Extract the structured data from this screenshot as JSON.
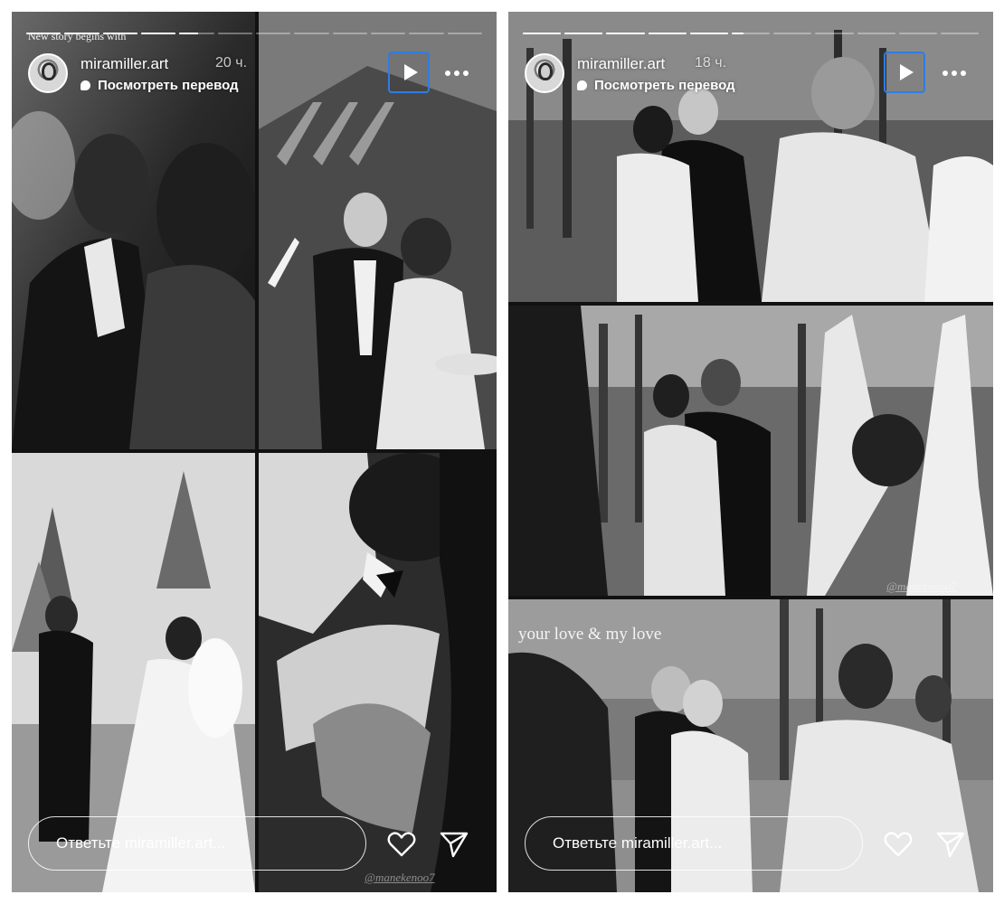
{
  "stories": [
    {
      "username": "miramiller.art",
      "time": "20 ч.",
      "translate_label": "Посмотреть перевод",
      "caption_top": "New story begins with",
      "watermark": "@manekenoo7",
      "reply_placeholder": "Ответьте miramiller.art...",
      "progress": [
        1,
        1,
        1,
        1,
        0.55,
        0,
        0,
        0,
        0,
        0,
        0,
        0
      ]
    },
    {
      "username": "miramiller.art",
      "time": "18 ч.",
      "translate_label": "Посмотреть перевод",
      "overlay_text": "your love & my love",
      "watermark": "@manekenoo7",
      "reply_placeholder": "Ответьте miramiller.art...",
      "progress": [
        1,
        1,
        1,
        1,
        1,
        0.3,
        0,
        0,
        0,
        0,
        0
      ]
    }
  ],
  "colors": {
    "focus_ring": "#2f7de1",
    "text": "#ffffff"
  },
  "icons": {
    "play": "play-icon",
    "more": "more-icon",
    "heart": "heart-icon",
    "send": "send-icon",
    "translate": "speech-bubble-icon"
  }
}
